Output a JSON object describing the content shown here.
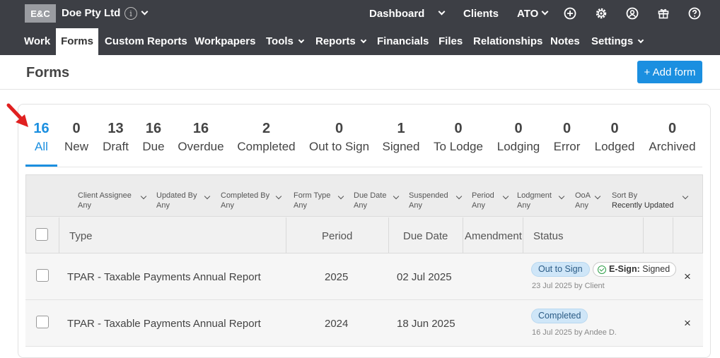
{
  "header": {
    "logo": "E&C",
    "org_name": "Doe Pty Ltd",
    "org_info_glyph": "i",
    "links": {
      "dashboard": "Dashboard",
      "clients": "Clients",
      "ato": "ATO"
    },
    "icons": [
      "add-circle-icon",
      "settings-icon",
      "account-icon",
      "gift-icon",
      "help-icon"
    ]
  },
  "nav": {
    "items": [
      "Work",
      "Forms",
      "Custom Reports",
      "Workpapers",
      "Tools",
      "Reports",
      "Financials",
      "Files",
      "Relationships",
      "Notes",
      "Settings"
    ],
    "active": "Forms"
  },
  "page": {
    "title": "Forms",
    "add_button": "+ Add form"
  },
  "tabs": [
    {
      "count": "16",
      "label": "All",
      "active": true
    },
    {
      "count": "0",
      "label": "New"
    },
    {
      "count": "13",
      "label": "Draft"
    },
    {
      "count": "16",
      "label": "Due"
    },
    {
      "count": "16",
      "label": "Overdue"
    },
    {
      "count": "2",
      "label": "Completed"
    },
    {
      "count": "0",
      "label": "Out to Sign"
    },
    {
      "count": "1",
      "label": "Signed"
    },
    {
      "count": "0",
      "label": "To Lodge"
    },
    {
      "count": "0",
      "label": "Lodging"
    },
    {
      "count": "0",
      "label": "Error"
    },
    {
      "count": "0",
      "label": "Lodged"
    },
    {
      "count": "0",
      "label": "Archived"
    }
  ],
  "filters": [
    {
      "label": "Client Assignee",
      "value": "Any"
    },
    {
      "label": "Updated By",
      "value": "Any"
    },
    {
      "label": "Completed By",
      "value": "Any"
    },
    {
      "label": "Form Type",
      "value": "Any"
    },
    {
      "label": "Due Date",
      "value": "Any"
    },
    {
      "label": "Suspended",
      "value": "Any"
    },
    {
      "label": "Period",
      "value": "Any"
    },
    {
      "label": "Lodgment",
      "value": "Any"
    },
    {
      "label": "OoA",
      "value": "Any"
    },
    {
      "label": "Sort By",
      "value": "Recently Updated"
    }
  ],
  "table": {
    "columns": {
      "type": "Type",
      "period": "Period",
      "due_date": "Due Date",
      "amendment": "Amendment",
      "status": "Status"
    },
    "rows": [
      {
        "type": "TPAR - Taxable Payments Annual Report",
        "period": "2025",
        "due_date": "02 Jul 2025",
        "status": "Out to Sign",
        "esign_label": "E-Sign:",
        "esign_value": "Signed",
        "note": "23 Jul 2025 by Client"
      },
      {
        "type": "TPAR - Taxable Payments Annual Report",
        "period": "2024",
        "due_date": "18 Jun 2025",
        "status": "Completed",
        "note": "16 Jul 2025 by Andee D."
      }
    ],
    "remove_glyph": "×"
  },
  "colors": {
    "header_bg": "#3d3f45",
    "accent": "#1b8fe0",
    "annotation_arrow": "#e02020"
  }
}
